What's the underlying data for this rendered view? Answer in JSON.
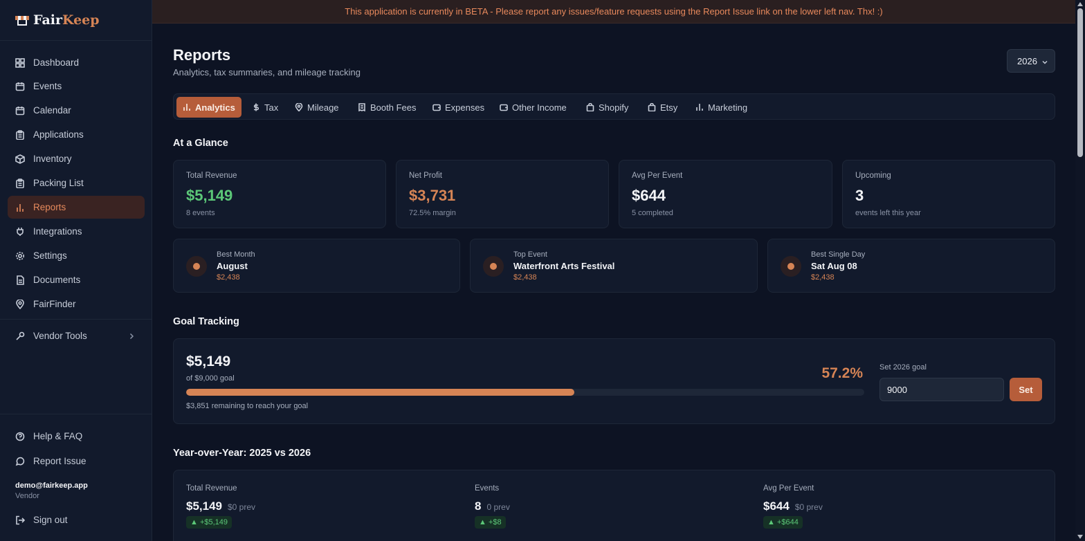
{
  "app": {
    "brand_part1": "Fair",
    "brand_part2": "Keep"
  },
  "banner": "This application is currently in BETA - Please report any issues/feature requests using the Report Issue link on the lower left nav. Thx! :)",
  "sidebar": {
    "items": [
      {
        "label": "Dashboard",
        "icon": "grid-icon"
      },
      {
        "label": "Events",
        "icon": "calendar-icon"
      },
      {
        "label": "Calendar",
        "icon": "calendar-icon"
      },
      {
        "label": "Applications",
        "icon": "clipboard-icon"
      },
      {
        "label": "Inventory",
        "icon": "box-icon"
      },
      {
        "label": "Packing List",
        "icon": "clipboard-icon"
      },
      {
        "label": "Reports",
        "icon": "bar-chart-icon",
        "active": true
      },
      {
        "label": "Integrations",
        "icon": "plug-icon"
      },
      {
        "label": "Settings",
        "icon": "gear-icon"
      },
      {
        "label": "Documents",
        "icon": "document-icon"
      },
      {
        "label": "FairFinder",
        "icon": "map-pin-icon"
      }
    ],
    "vendor_tools": "Vendor Tools",
    "help": "Help & FAQ",
    "report_issue": "Report Issue",
    "user_email": "demo@fairkeep.app",
    "user_role": "Vendor",
    "sign_out": "Sign out"
  },
  "page": {
    "title": "Reports",
    "subtitle": "Analytics, tax summaries, and mileage tracking",
    "year": "2026"
  },
  "tabs": [
    {
      "label": "Analytics",
      "icon": "bar-chart-icon",
      "active": true
    },
    {
      "label": "Tax",
      "icon": "dollar-icon"
    },
    {
      "label": "Mileage",
      "icon": "map-pin-icon"
    },
    {
      "label": "Booth Fees",
      "icon": "receipt-icon"
    },
    {
      "label": "Expenses",
      "icon": "wallet-icon"
    },
    {
      "label": "Other Income",
      "icon": "wallet-icon"
    },
    {
      "label": "Shopify",
      "icon": "shopping-bag-icon"
    },
    {
      "label": "Etsy",
      "icon": "shopping-bag-icon"
    },
    {
      "label": "Marketing",
      "icon": "bar-chart-icon"
    }
  ],
  "glance": {
    "title": "At a Glance",
    "stats": [
      {
        "label": "Total Revenue",
        "value": "$5,149",
        "sub": "8 events",
        "color": "#5cc878"
      },
      {
        "label": "Net Profit",
        "value": "$3,731",
        "sub": "72.5% margin",
        "color": "#d68455"
      },
      {
        "label": "Avg Per Event",
        "value": "$644",
        "sub": "5 completed",
        "color": "#f3f4f7"
      },
      {
        "label": "Upcoming",
        "value": "3",
        "sub": "events left this year",
        "color": "#f3f4f7"
      }
    ],
    "highlights": [
      {
        "label": "Best Month",
        "value": "August",
        "amount": "$2,438"
      },
      {
        "label": "Top Event",
        "value": "Waterfront Arts Festival",
        "amount": "$2,438"
      },
      {
        "label": "Best Single Day",
        "value": "Sat Aug 08",
        "amount": "$2,438"
      }
    ]
  },
  "goal": {
    "title": "Goal Tracking",
    "amount": "$5,149",
    "of_goal": "of $9,000 goal",
    "percent_label": "57.2%",
    "progress": 0.572,
    "remaining": "$3,851 remaining to reach your goal",
    "set_label": "Set 2026 goal",
    "input_value": "9000",
    "button": "Set"
  },
  "yoy": {
    "title": "Year-over-Year: 2025 vs 2026",
    "items": [
      {
        "label": "Total Revenue",
        "value": "$5,149",
        "prev": "$0 prev",
        "delta": "▲ +$5,149"
      },
      {
        "label": "Events",
        "value": "8",
        "prev": "0 prev",
        "delta": "▲ +$8"
      },
      {
        "label": "Avg Per Event",
        "value": "$644",
        "prev": "$0 prev",
        "delta": "▲ +$644"
      }
    ]
  }
}
